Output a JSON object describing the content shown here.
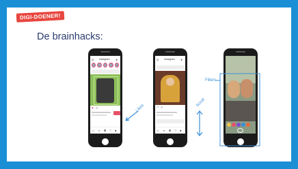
{
  "badge": {
    "text": "DIGI-DOENER!"
  },
  "slide": {
    "title": "De brainhacks:"
  },
  "phones": [
    {
      "app_title": "Instagram"
    },
    {
      "app_title": "Instagram"
    },
    {
      "app_title": ""
    }
  ],
  "annotations": {
    "left_arrow_label": "Likes",
    "scroll_label": "Scroll",
    "filters_label": "Filters"
  },
  "colors": {
    "frame": "#1a8fd6",
    "badge": "#e8463e",
    "title": "#2b3a6e",
    "annotation": "#3b8fd8",
    "like_button": "#e8506a"
  }
}
